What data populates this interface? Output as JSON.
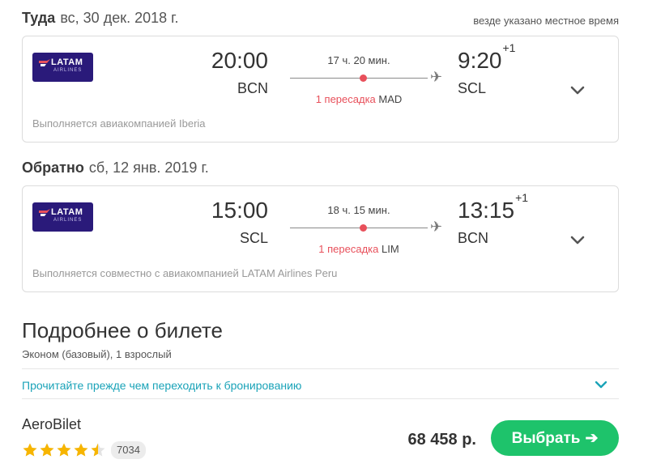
{
  "note": "везде указано местное время",
  "outbound": {
    "label": "Туда",
    "date": "вс, 30 дек. 2018 г.",
    "airline_logo": {
      "brand": "LATAM",
      "sub": "AIRLINES"
    },
    "dep_time": "20:00",
    "dep_code": "BCN",
    "duration": "17 ч. 20 мин.",
    "stops_count": "1 пересадка",
    "stops_via": "MAD",
    "arr_time": "9:20",
    "arr_day_offset": "+1",
    "arr_code": "SCL",
    "operated": "Выполняется авиакомпанией Iberia"
  },
  "return": {
    "label": "Обратно",
    "date": "сб, 12 янв. 2019 г.",
    "airline_logo": {
      "brand": "LATAM",
      "sub": "AIRLINES"
    },
    "dep_time": "15:00",
    "dep_code": "SCL",
    "duration": "18 ч. 15 мин.",
    "stops_count": "1 пересадка",
    "stops_via": "LIM",
    "arr_time": "13:15",
    "arr_day_offset": "+1",
    "arr_code": "BCN",
    "operated": "Выполняется совместно с авиакомпанией LATAM Airlines Peru"
  },
  "details": {
    "title": "Подробнее о билете",
    "subtitle": "Эконом (базовый), 1 взрослый",
    "notice_link": "Прочитайте прежде чем переходить к бронированию"
  },
  "offer": {
    "agency": "AeroBilet",
    "rating_stars": 4.5,
    "rating_count": "7034",
    "price": "68 458 р.",
    "select_label": "Выбрать",
    "select_arrow": "➔"
  },
  "icons": {
    "plane": "✈",
    "stop_dot_color": "#e8505b",
    "star_color": "#f7b500",
    "accent": "#1aa3b8",
    "button_color": "#1ec36b"
  }
}
